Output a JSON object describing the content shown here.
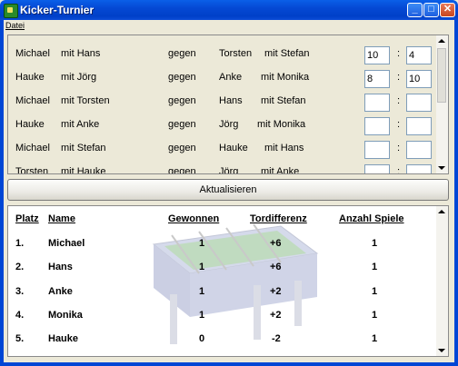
{
  "window": {
    "title": "Kicker-Turnier"
  },
  "menu": {
    "items": [
      "Datei"
    ]
  },
  "matches": {
    "rows": [
      {
        "team1_p1": "Michael",
        "team1_p2": "mit Hans",
        "vs": "gegen",
        "team2_p1": "Torsten",
        "team2_p2": "mit Stefan",
        "score1": "10",
        "sep": ":",
        "score2": "4"
      },
      {
        "team1_p1": "Hauke",
        "team1_p2": "mit Jörg",
        "vs": "gegen",
        "team2_p1": "Anke",
        "team2_p2": "mit Monika",
        "score1": "8",
        "sep": ":",
        "score2": "10"
      },
      {
        "team1_p1": "Michael",
        "team1_p2": "mit Torsten",
        "vs": "gegen",
        "team2_p1": "Hans",
        "team2_p2": "mit Stefan",
        "score1": "",
        "sep": ":",
        "score2": ""
      },
      {
        "team1_p1": "Hauke",
        "team1_p2": "mit Anke",
        "vs": "gegen",
        "team2_p1": "Jörg",
        "team2_p2": "mit Monika",
        "score1": "",
        "sep": ":",
        "score2": ""
      },
      {
        "team1_p1": "Michael",
        "team1_p2": "mit Stefan",
        "vs": "gegen",
        "team2_p1": "Hauke",
        "team2_p2": "mit Hans",
        "score1": "",
        "sep": ":",
        "score2": ""
      },
      {
        "team1_p1": "Torsten",
        "team1_p2": "mit Hauke",
        "vs": "gegen",
        "team2_p1": "Jörg",
        "team2_p2": "mit Anke",
        "score1": "",
        "sep": ":",
        "score2": ""
      }
    ]
  },
  "update_button": {
    "label": "Aktualisieren"
  },
  "ranking": {
    "headers": {
      "platz": "Platz",
      "name": "Name",
      "gewonnen": "Gewonnen",
      "tordifferenz": "Tordifferenz",
      "anzahl": "Anzahl Spiele"
    },
    "rows": [
      {
        "platz": "1.",
        "name": "Michael",
        "gewonnen": "1",
        "tordifferenz": "+6",
        "anzahl": "1"
      },
      {
        "platz": "2.",
        "name": "Hans",
        "gewonnen": "1",
        "tordifferenz": "+6",
        "anzahl": "1"
      },
      {
        "platz": "3.",
        "name": "Anke",
        "gewonnen": "1",
        "tordifferenz": "+2",
        "anzahl": "1"
      },
      {
        "platz": "4.",
        "name": "Monika",
        "gewonnen": "1",
        "tordifferenz": "+2",
        "anzahl": "1"
      },
      {
        "platz": "5.",
        "name": "Hauke",
        "gewonnen": "0",
        "tordifferenz": "-2",
        "anzahl": "1"
      }
    ]
  },
  "icons": {
    "app": "foosball-app-icon",
    "minimize": "minimize-icon",
    "maximize": "maximize-icon",
    "close": "close-icon"
  },
  "colors": {
    "titlebar": "#0A5FE8",
    "window_bg": "#ECE9D8",
    "close_button": "#E8795A"
  }
}
